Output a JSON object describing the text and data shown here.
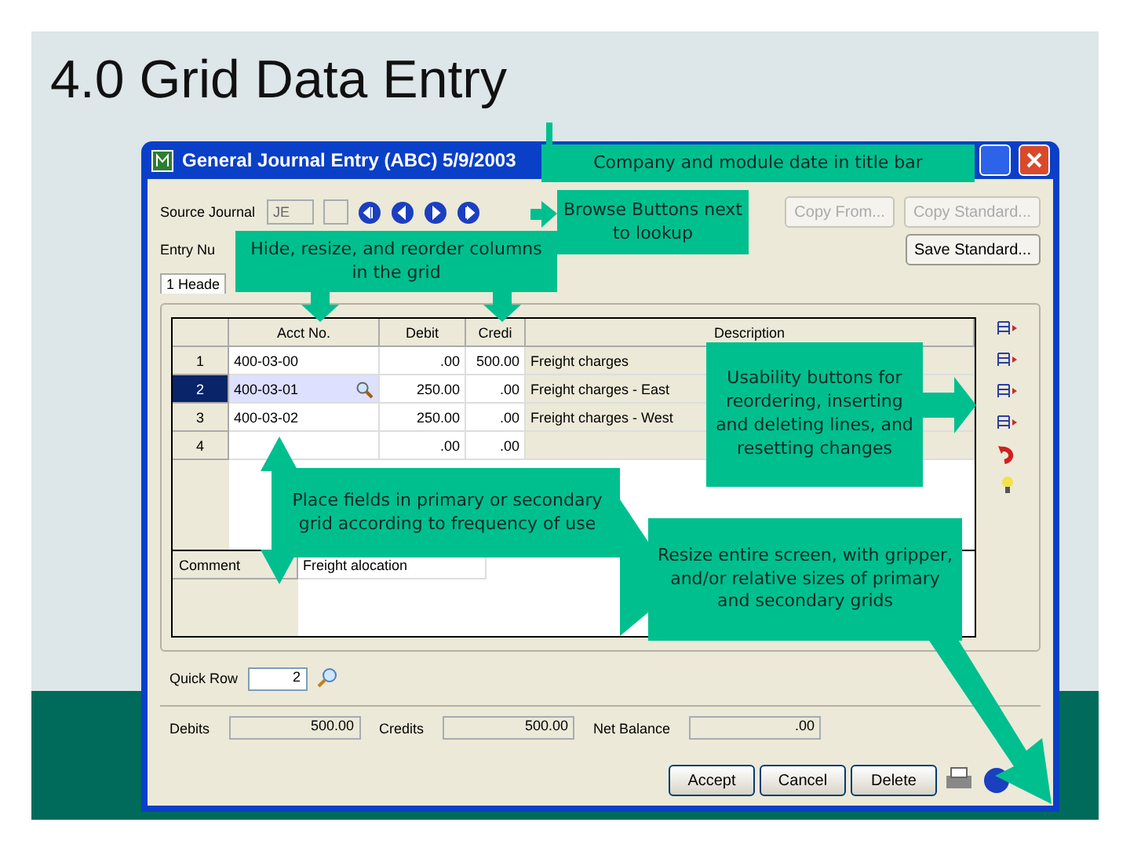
{
  "slide": {
    "title": "4.0 Grid Data Entry"
  },
  "window": {
    "title": "General Journal Entry (ABC) 5/9/2003",
    "source_journal": {
      "label": "Source Journal",
      "value": "JE"
    },
    "entry_number": {
      "label": "Entry Nu"
    },
    "tab": {
      "label": "1 Heade"
    },
    "top_buttons": [
      {
        "label": "Copy From...",
        "disabled": true
      },
      {
        "label": "Copy Standard...",
        "disabled": true
      },
      {
        "label": "Save Standard...",
        "disabled": false
      }
    ],
    "grid": {
      "columns": [
        "Acct No.",
        "Debit",
        "Credi",
        "Description"
      ],
      "rows": [
        {
          "number": "1",
          "acct": "400-03-00",
          "debit": ".00",
          "credit": "500.00",
          "description": "Freight charges",
          "selected": false
        },
        {
          "number": "2",
          "acct": "400-03-01",
          "debit": "250.00",
          "credit": ".00",
          "description": "Freight charges - East",
          "selected": true
        },
        {
          "number": "3",
          "acct": "400-03-02",
          "debit": "250.00",
          "credit": ".00",
          "description": "Freight charges - West",
          "selected": false
        },
        {
          "number": "4",
          "acct": "",
          "debit": ".00",
          "credit": ".00",
          "description": "",
          "selected": false
        }
      ]
    },
    "comment": {
      "label": "Comment",
      "value": "Freight alocation"
    },
    "quick_row": {
      "label": "Quick Row",
      "value": "2"
    },
    "totals": [
      {
        "label": "Debits",
        "value": "500.00"
      },
      {
        "label": "Credits",
        "value": "500.00"
      },
      {
        "label": "Net Balance",
        "value": ".00"
      }
    ],
    "buttons": [
      {
        "label": "Accept"
      },
      {
        "label": "Cancel"
      },
      {
        "label": "Delete"
      }
    ]
  },
  "callouts": [
    {
      "text": "Company and module date in title bar"
    },
    {
      "text": "Browse Buttons next to lookup"
    },
    {
      "text": "Hide, resize, and reorder columns in the grid"
    },
    {
      "text": "Place fields in primary or secondary grid according to frequency of use"
    },
    {
      "text": "Usability buttons for reordering, inserting and deleting lines, and resetting changes"
    },
    {
      "text": "Resize entire screen, with gripper, and/or relative sizes of primary and secondary grids"
    }
  ]
}
